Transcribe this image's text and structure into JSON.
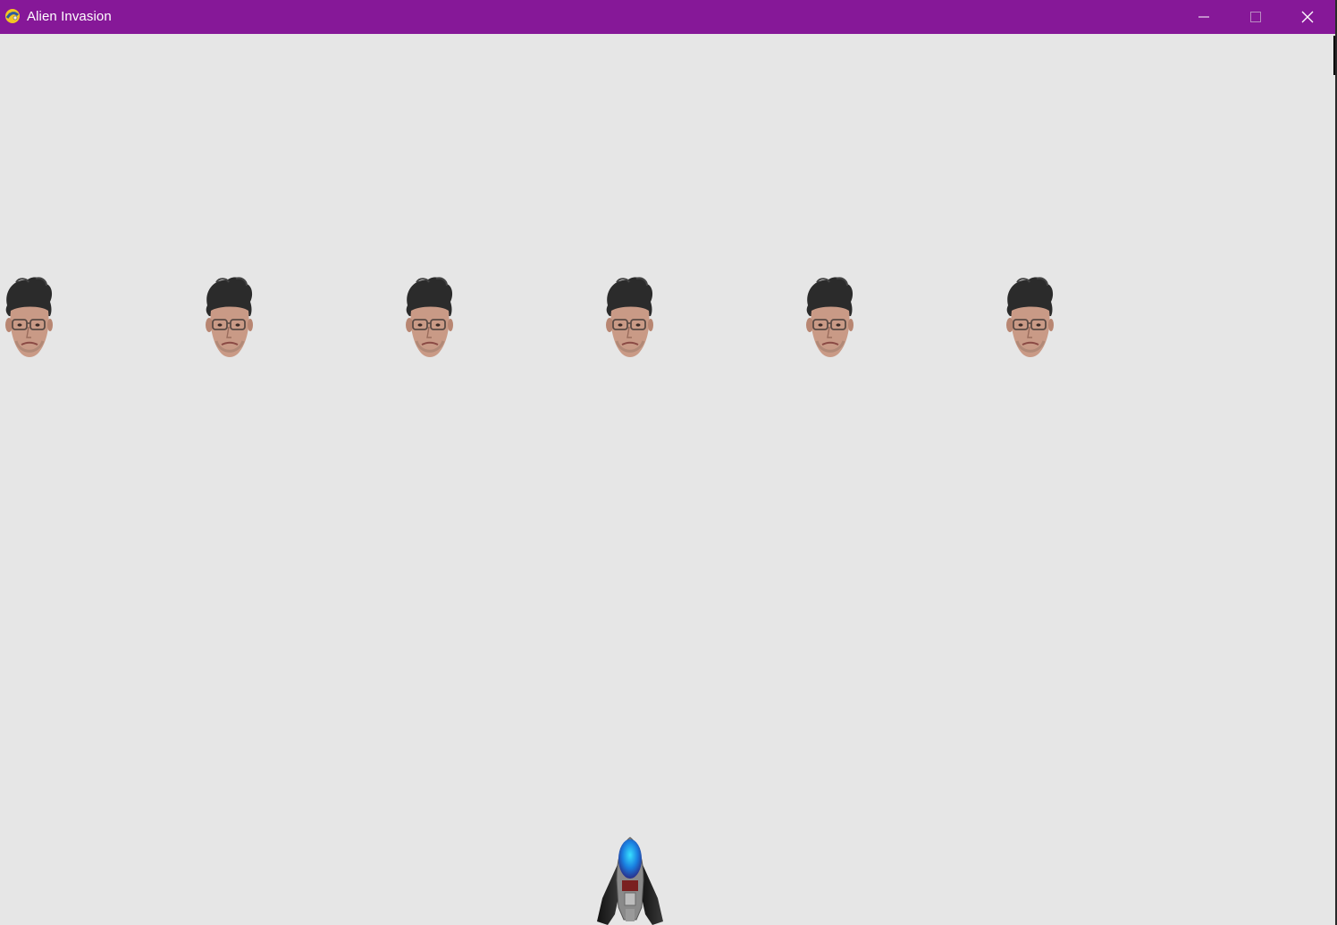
{
  "window": {
    "title": "Alien Invasion",
    "app_icon": "pygame-snake-icon",
    "titlebar_color": "#861898",
    "background_color": "#e6e6e6",
    "controls": {
      "minimize": "minimize-icon",
      "maximize": "maximize-icon",
      "close": "close-icon"
    }
  },
  "game": {
    "aliens": [
      {
        "sprite": "alien-face"
      },
      {
        "sprite": "alien-face"
      },
      {
        "sprite": "alien-face"
      },
      {
        "sprite": "alien-face"
      },
      {
        "sprite": "alien-face"
      },
      {
        "sprite": "alien-face"
      }
    ],
    "ship": {
      "sprite": "ship-icon",
      "cockpit_color": "#1a8fe0"
    }
  }
}
